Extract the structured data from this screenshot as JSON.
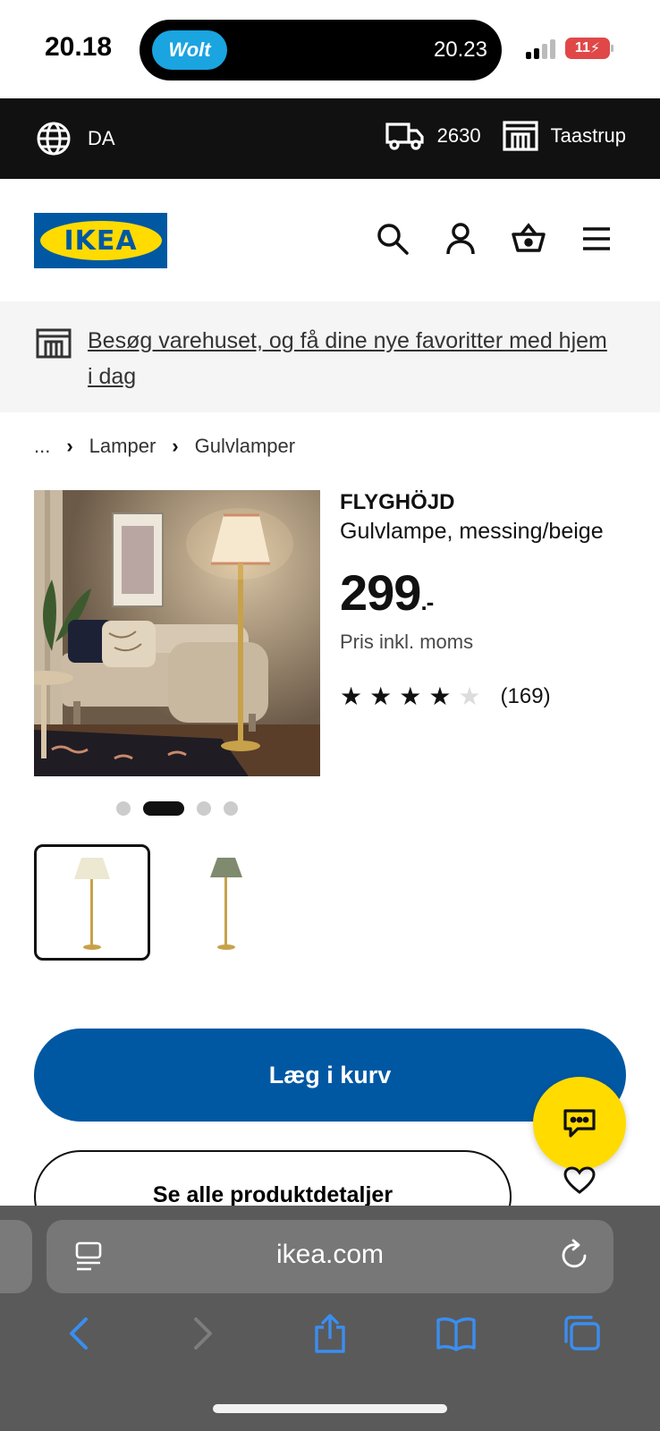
{
  "status_bar": {
    "time": "20.18",
    "activity_app": "Wolt",
    "activity_time": "20.23",
    "battery": "11"
  },
  "top_strip": {
    "language": "DA",
    "postal_code": "2630",
    "store": "Taastrup"
  },
  "header": {
    "logo_text": "IKEA"
  },
  "banner": {
    "text": "Besøg varehuset, og få dine nye favoritter med hjem i dag"
  },
  "breadcrumb": {
    "ellipsis": "...",
    "items": [
      "Lamper",
      "Gulvlamper"
    ]
  },
  "product": {
    "name": "FLYGHÖJD",
    "description": "Gulvlampe, messing/beige",
    "price": "299",
    "price_suffix": ".-",
    "price_note": "Pris inkl. moms",
    "rating": 4,
    "rating_max": 5,
    "review_count": "(169)",
    "carousel_active_index": 1,
    "carousel_count": 4
  },
  "actions": {
    "add_to_cart": "Læg i kurv",
    "see_details": "Se alle produktdetaljer"
  },
  "safari": {
    "url": "ikea.com"
  },
  "colors": {
    "ikea_blue": "#0058a3",
    "ikea_yellow": "#ffdb00",
    "strip_black": "#111111",
    "safari_gray": "#5a5a5a",
    "safari_accent": "#3a8ef0"
  }
}
